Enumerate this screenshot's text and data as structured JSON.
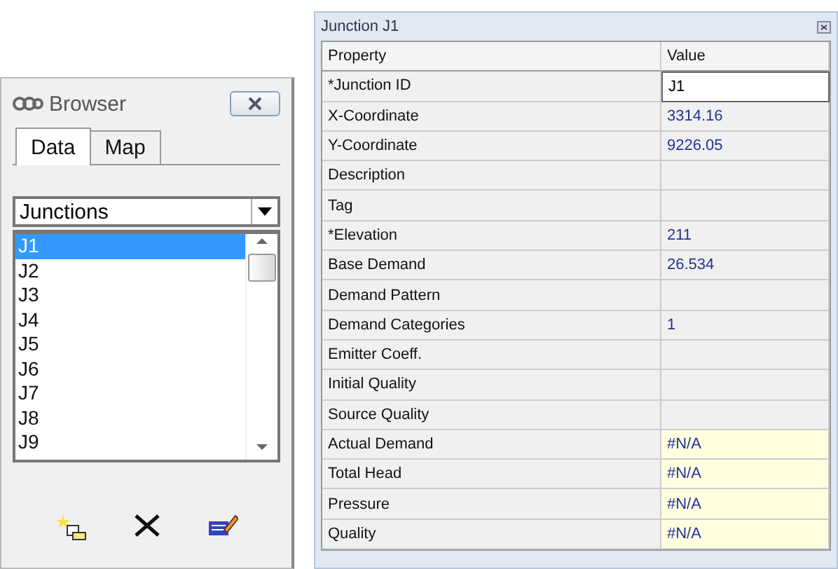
{
  "browser": {
    "title": "Browser",
    "tabs": [
      {
        "label": "Data",
        "selected": true
      },
      {
        "label": "Map",
        "selected": false
      }
    ],
    "dropdown": {
      "value": "Junctions"
    },
    "items": [
      {
        "label": "J1",
        "selected": true
      },
      {
        "label": "J2",
        "selected": false
      },
      {
        "label": "J3",
        "selected": false
      },
      {
        "label": "J4",
        "selected": false
      },
      {
        "label": "J5",
        "selected": false
      },
      {
        "label": "J6",
        "selected": false
      },
      {
        "label": "J7",
        "selected": false
      },
      {
        "label": "J8",
        "selected": false
      },
      {
        "label": "J9",
        "selected": false
      }
    ]
  },
  "editor": {
    "title": "Junction J1",
    "columns": [
      "Property",
      "Value"
    ],
    "rows": [
      {
        "property": "*Junction ID",
        "value": "J1",
        "kind": "input"
      },
      {
        "property": "X-Coordinate",
        "value": "3314.16",
        "kind": "text"
      },
      {
        "property": "Y-Coordinate",
        "value": "9226.05",
        "kind": "text"
      },
      {
        "property": "Description",
        "kind": "text"
      },
      {
        "property": "Tag",
        "kind": "text"
      },
      {
        "property": "*Elevation",
        "value": "211",
        "kind": "text"
      },
      {
        "property": "Base Demand",
        "value": "26.534",
        "kind": "text"
      },
      {
        "property": "Demand Pattern",
        "kind": "text"
      },
      {
        "property": "Demand Categories",
        "value": "1",
        "kind": "text"
      },
      {
        "property": "Emitter Coeff.",
        "kind": "text"
      },
      {
        "property": "Initial Quality",
        "kind": "text"
      },
      {
        "property": "Source Quality",
        "kind": "text"
      },
      {
        "property": "Actual Demand",
        "value": "#N/A",
        "kind": "result"
      },
      {
        "property": "Total Head",
        "value": "#N/A",
        "kind": "result"
      },
      {
        "property": "Pressure",
        "value": "#N/A",
        "kind": "result"
      },
      {
        "property": "Quality",
        "value": "#N/A",
        "kind": "result"
      }
    ]
  }
}
